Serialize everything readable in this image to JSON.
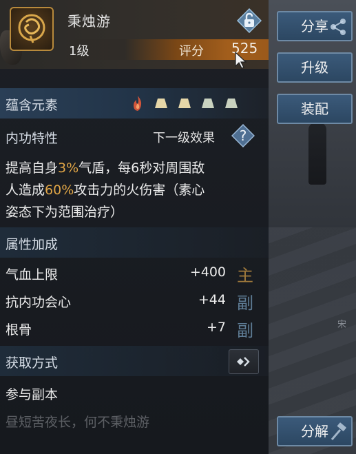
{
  "item": {
    "name": "秉烛游",
    "level": "1级",
    "score_label": "评分",
    "score_value": "525",
    "icon": "lock-open-icon"
  },
  "elements": {
    "label": "蕴含元素",
    "icons": [
      "fire-element-icon",
      "empty-slot-icon",
      "empty-slot-icon",
      "empty-slot-icon",
      "empty-slot-icon"
    ]
  },
  "internal": {
    "label": "内功特性",
    "next_effect": "下一级效果",
    "help_icon": "question-icon",
    "desc": {
      "p1": "提高自身",
      "h1": "3%",
      "p2": "气盾，每6秒对周围敌",
      "p3": "人造成",
      "h2": "60%",
      "p4": "攻击力的火伤害（素心",
      "p5": "姿态下为范围治疗）"
    }
  },
  "attributes": {
    "label": "属性加成",
    "rows": [
      {
        "name": "气血上限",
        "value": "+400",
        "tag": "主"
      },
      {
        "name": "抗内功会心",
        "value": "+44",
        "tag": "副"
      },
      {
        "name": "根骨",
        "value": "+7",
        "tag": "副"
      }
    ]
  },
  "source": {
    "label": "获取方式",
    "value": "参与副本",
    "faded_text": "昼短苦夜长，何不秉烛游"
  },
  "buttons": {
    "share": "分享",
    "upgrade": "升级",
    "equip": "装配",
    "dismantle": "分解"
  },
  "colors": {
    "highlight": "#e2a646",
    "main_tag": "#a07a3c",
    "sub_tag": "#5e7c95",
    "score_bar": "#a25e1c",
    "button": "#3b5a7a"
  }
}
